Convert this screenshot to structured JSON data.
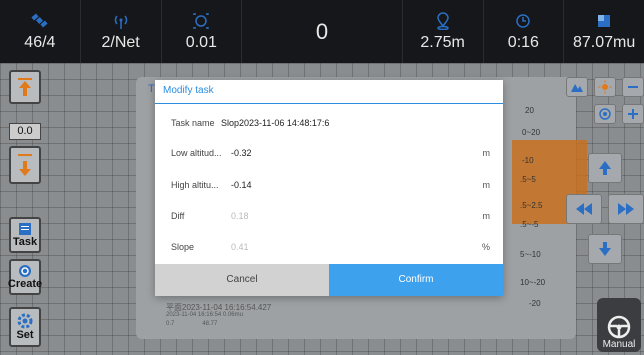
{
  "status_bar": {
    "satellites": "46/4",
    "signal": "2/Net",
    "accuracy": "0.01",
    "center_value": "0",
    "height": "2.75m",
    "time": "0:16",
    "area": "87.07mu"
  },
  "left_toolbar": {
    "offset_value": "0.0",
    "task_label": "Task",
    "create_label": "Create",
    "set_label": "Set"
  },
  "background_task": {
    "title_fragment": "T",
    "entry_name": "平面2023-11-04 16:16:54.427",
    "entry_time_area": "2023-11-04 16:16:54   0.06mu",
    "entry_val1": "0.7",
    "entry_val2": "48.77"
  },
  "legend": {
    "labels": [
      "20",
      "0~20",
      "-10",
      ".5~5",
      ".5~2.5",
      ".5~-5",
      "5~-10",
      "10~-20",
      "-20"
    ]
  },
  "dialog": {
    "title": "Modify task",
    "task_name_label": "Task name",
    "task_name_value": "Slop2023-11-06 14:48:17:6",
    "low_label": "Low altitud...",
    "low_value": "-0.32",
    "low_unit": "m",
    "high_label": "High altitu...",
    "high_value": "-0.14",
    "high_unit": "m",
    "diff_label": "Diff",
    "diff_value": "0.18",
    "diff_unit": "m",
    "slope_label": "Slope",
    "slope_value": "0.41",
    "slope_unit": "%",
    "cancel_label": "Cancel",
    "confirm_label": "Confirm"
  },
  "manual_label": "Manual",
  "colors": {
    "accent": "#3da1ee",
    "legend_orange": "#c8701e",
    "arrow_orange": "#e07a1a",
    "arrow_blue": "#2a6fc4"
  }
}
